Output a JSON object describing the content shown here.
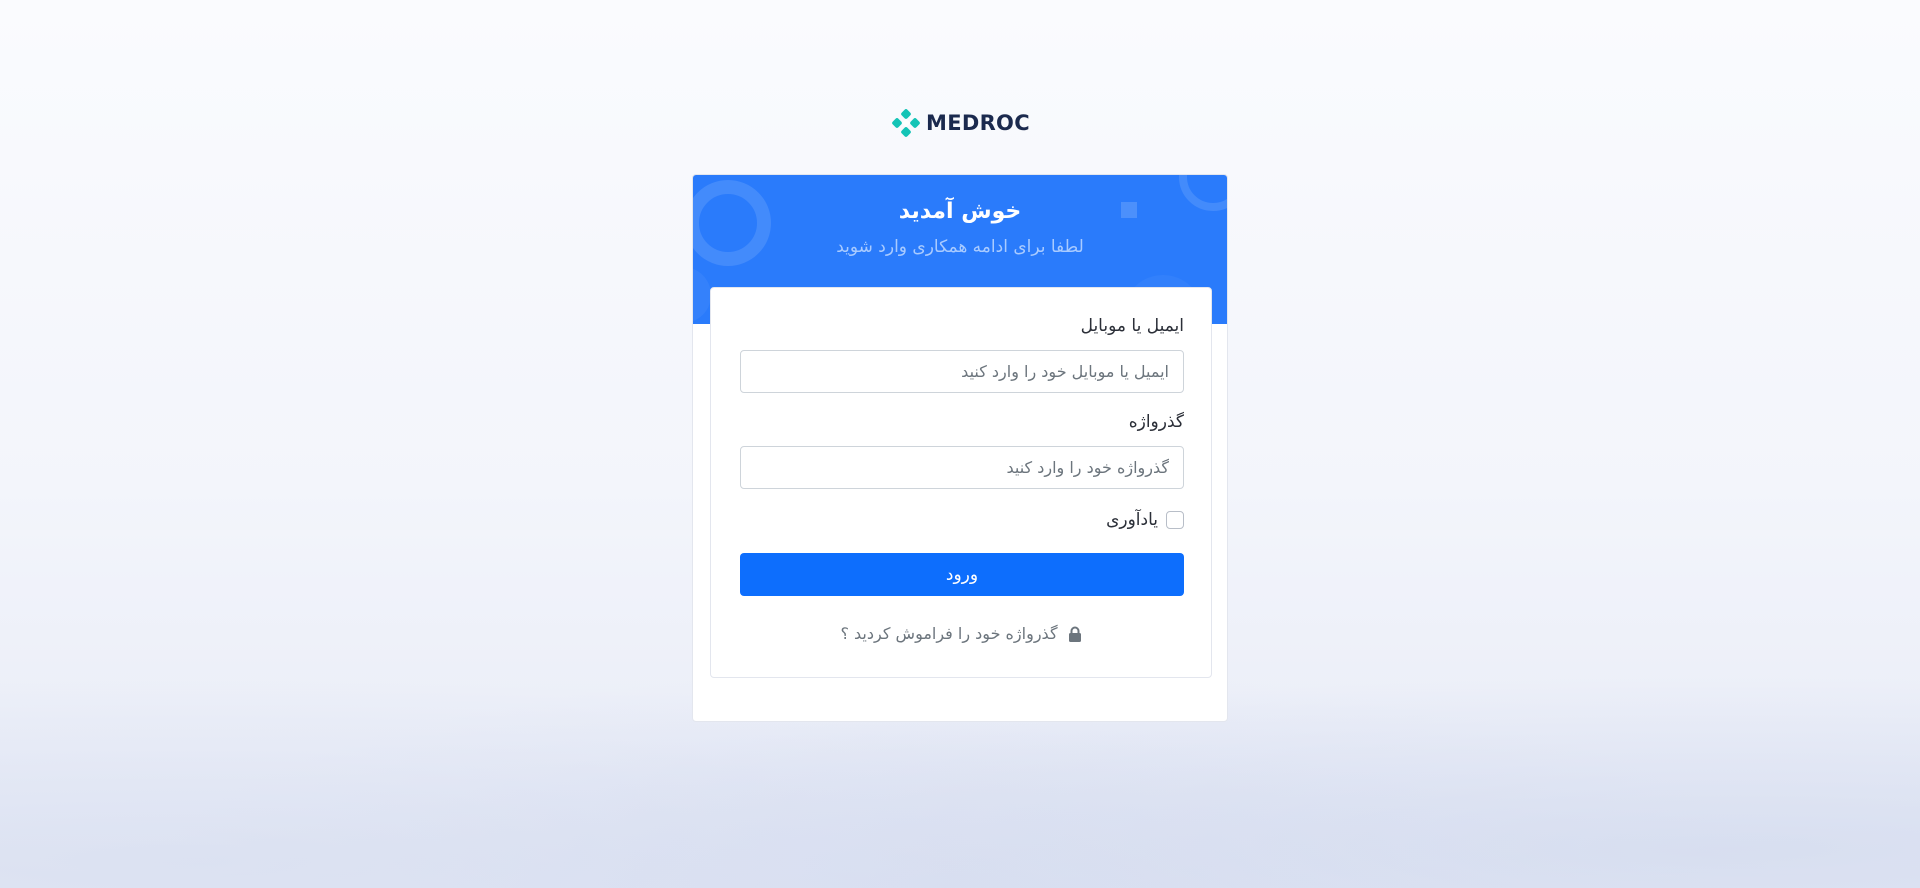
{
  "brand": {
    "logo_text": "MEDROC",
    "logo_icon": "medroc-logo-icon",
    "accent_color": "#14c4b6"
  },
  "header": {
    "title": "خوش آمدید",
    "subtitle": "لطفا برای ادامه همکاری وارد شوید",
    "background_color": "#2a7bfb"
  },
  "form": {
    "email_label": "ایمیل یا موبایل",
    "email_value": "",
    "email_placeholder": "ایمیل یا موبایل خود را وارد کنید",
    "password_label": "گذرواژه",
    "password_value": "",
    "password_placeholder": "گذرواژه خود را وارد کنید",
    "remember_label": "یادآوری",
    "remember_checked": false,
    "login_label": "ورود",
    "login_color": "#0d6efd",
    "forgot_label": "گذرواژه خود را فراموش کردید ؟",
    "forgot_icon": "lock-icon"
  }
}
